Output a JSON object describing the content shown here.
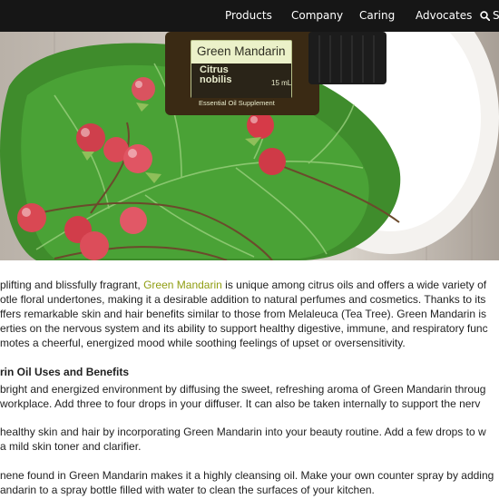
{
  "nav": {
    "items": [
      "Products",
      "Company",
      "Caring",
      "Advocates"
    ],
    "search_label": "S"
  },
  "hero": {
    "image": "Essential oil bottle on a leaf with red berries",
    "bottle": {
      "name": "Green Mandarin",
      "latin_line1": "Citrus",
      "latin_line2": "nobilis",
      "volume": "15 mL",
      "subtitle": "Essential Oil Supplement"
    }
  },
  "article": {
    "p1": {
      "line1_pre": "plifting and blissfully fragrant, ",
      "line1_link": "Green Mandarin",
      "line1_post": " is unique among citrus oils and offers a wide variety of",
      "line2": "otle floral undertones, making it a desirable addition to natural perfumes and cosmetics. Thanks to its",
      "line3": "ffers remarkable skin and hair benefits similar to those from Melaleuca (Tea Tree). Green Mandarin is",
      "line4": "erties on the nervous system and its ability to support healthy digestive, immune, and respiratory func",
      "line5": "motes a cheerful, energized mood while soothing feelings of upset or oversensitivity."
    },
    "heading": "rin Oil Uses and Benefits",
    "p2": {
      "line1": "bright and energized environment by diffusing the sweet, refreshing aroma of Green Mandarin throug",
      "line2": "workplace. Add three to four drops in your diffuser. It can also be taken internally to support the nerv"
    },
    "p3": {
      "line1": "healthy skin and hair by incorporating Green Mandarin into your beauty routine. Add a few drops to w",
      "line2": "a mild skin toner and clarifier."
    },
    "p4": {
      "line1": "nene found in Green Mandarin makes it a highly cleansing oil. Make your own counter spray by adding",
      "line2": "andarin to a spray bottle filled with water to clean the surfaces of your kitchen."
    }
  },
  "colors": {
    "nav_bg": "#161616",
    "link": "#8f9d12",
    "text": "#1f1f1f"
  }
}
